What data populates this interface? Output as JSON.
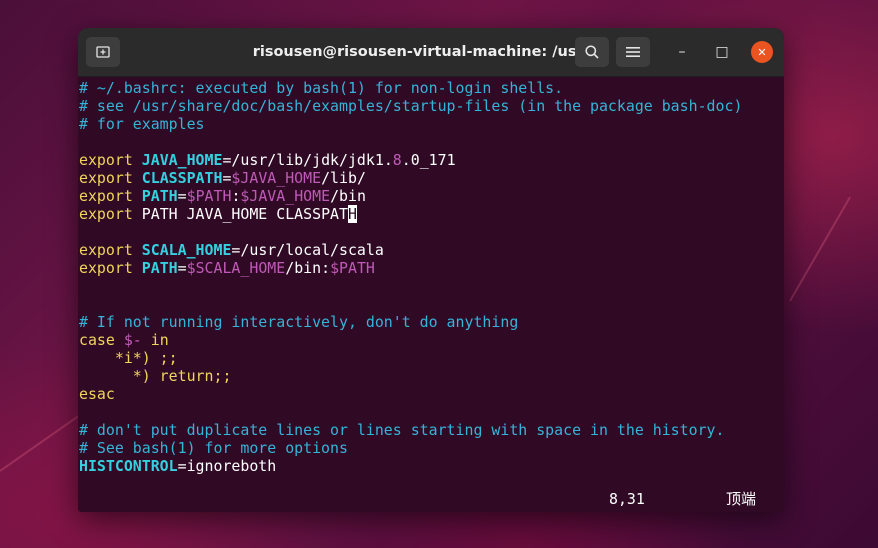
{
  "window": {
    "title": "risousen@risousen-virtual-machine: /usr/lib",
    "new_tab_icon": "new-tab-icon",
    "search_icon": "search-icon",
    "menu_icon": "hamburger-menu-icon",
    "minimize_glyph": "–",
    "maximize_glyph": "□",
    "close_glyph": "✕",
    "close_color": "#e95420"
  },
  "colors": {
    "terminal_bg": "#300a24",
    "comment": "#34b4d8",
    "keyword": "#f0d55c",
    "variable": "#34d0e0",
    "reference": "#c05ab8"
  },
  "terminal": {
    "lines": [
      [
        {
          "t": "# ~/.bashrc: executed by bash(1) for non-login shells.",
          "c": "comment"
        }
      ],
      [
        {
          "t": "# see /usr/share/doc/bash/examples/startup-files (in the package bash-doc)",
          "c": "comment"
        }
      ],
      [
        {
          "t": "# for examples",
          "c": "comment"
        }
      ],
      [],
      [
        {
          "t": "export ",
          "c": "kw"
        },
        {
          "t": "JAVA_HOME",
          "c": "var"
        },
        {
          "t": "=/usr/lib/jdk/jdk1.",
          "c": "plain"
        },
        {
          "t": "8",
          "c": "num"
        },
        {
          "t": ".0_171",
          "c": "plain"
        }
      ],
      [
        {
          "t": "export ",
          "c": "kw"
        },
        {
          "t": "CLASSPATH",
          "c": "var"
        },
        {
          "t": "=",
          "c": "plain"
        },
        {
          "t": "$JAVA_HOME",
          "c": "ref"
        },
        {
          "t": "/lib/",
          "c": "plain"
        }
      ],
      [
        {
          "t": "export ",
          "c": "kw"
        },
        {
          "t": "PATH",
          "c": "var"
        },
        {
          "t": "=",
          "c": "plain"
        },
        {
          "t": "$PATH",
          "c": "ref"
        },
        {
          "t": ":",
          "c": "plain"
        },
        {
          "t": "$JAVA_HOME",
          "c": "ref"
        },
        {
          "t": "/bin",
          "c": "plain"
        }
      ],
      [
        {
          "t": "export ",
          "c": "kw"
        },
        {
          "t": "PATH JAVA_HOME CLASSPAT",
          "c": "plain"
        },
        {
          "t": "H",
          "c": "cursor"
        }
      ],
      [],
      [
        {
          "t": "export ",
          "c": "kw"
        },
        {
          "t": "SCALA_HOME",
          "c": "var"
        },
        {
          "t": "=/usr/local/scala",
          "c": "plain"
        }
      ],
      [
        {
          "t": "export ",
          "c": "kw"
        },
        {
          "t": "PATH",
          "c": "var"
        },
        {
          "t": "=",
          "c": "plain"
        },
        {
          "t": "$SCALA_HOME",
          "c": "ref"
        },
        {
          "t": "/bin:",
          "c": "plain"
        },
        {
          "t": "$PATH",
          "c": "ref"
        }
      ],
      [],
      [],
      [
        {
          "t": "# If not running interactively, don't do anything",
          "c": "comment"
        }
      ],
      [
        {
          "t": "case ",
          "c": "kw"
        },
        {
          "t": "$-",
          "c": "ref"
        },
        {
          "t": " in",
          "c": "kw"
        }
      ],
      [
        {
          "t": "    *i*) ;;",
          "c": "kw"
        }
      ],
      [
        {
          "t": "      *) return;;",
          "c": "kw"
        }
      ],
      [
        {
          "t": "esac",
          "c": "kw"
        }
      ],
      [],
      [
        {
          "t": "# don't put duplicate lines or lines starting with space in the history.",
          "c": "comment"
        }
      ],
      [
        {
          "t": "# See bash(1) for more options",
          "c": "comment"
        }
      ],
      [
        {
          "t": "HISTCONTROL",
          "c": "var"
        },
        {
          "t": "=ignoreboth",
          "c": "plain"
        }
      ]
    ]
  },
  "statusbar": {
    "position": "8,31",
    "where": "顶端"
  }
}
